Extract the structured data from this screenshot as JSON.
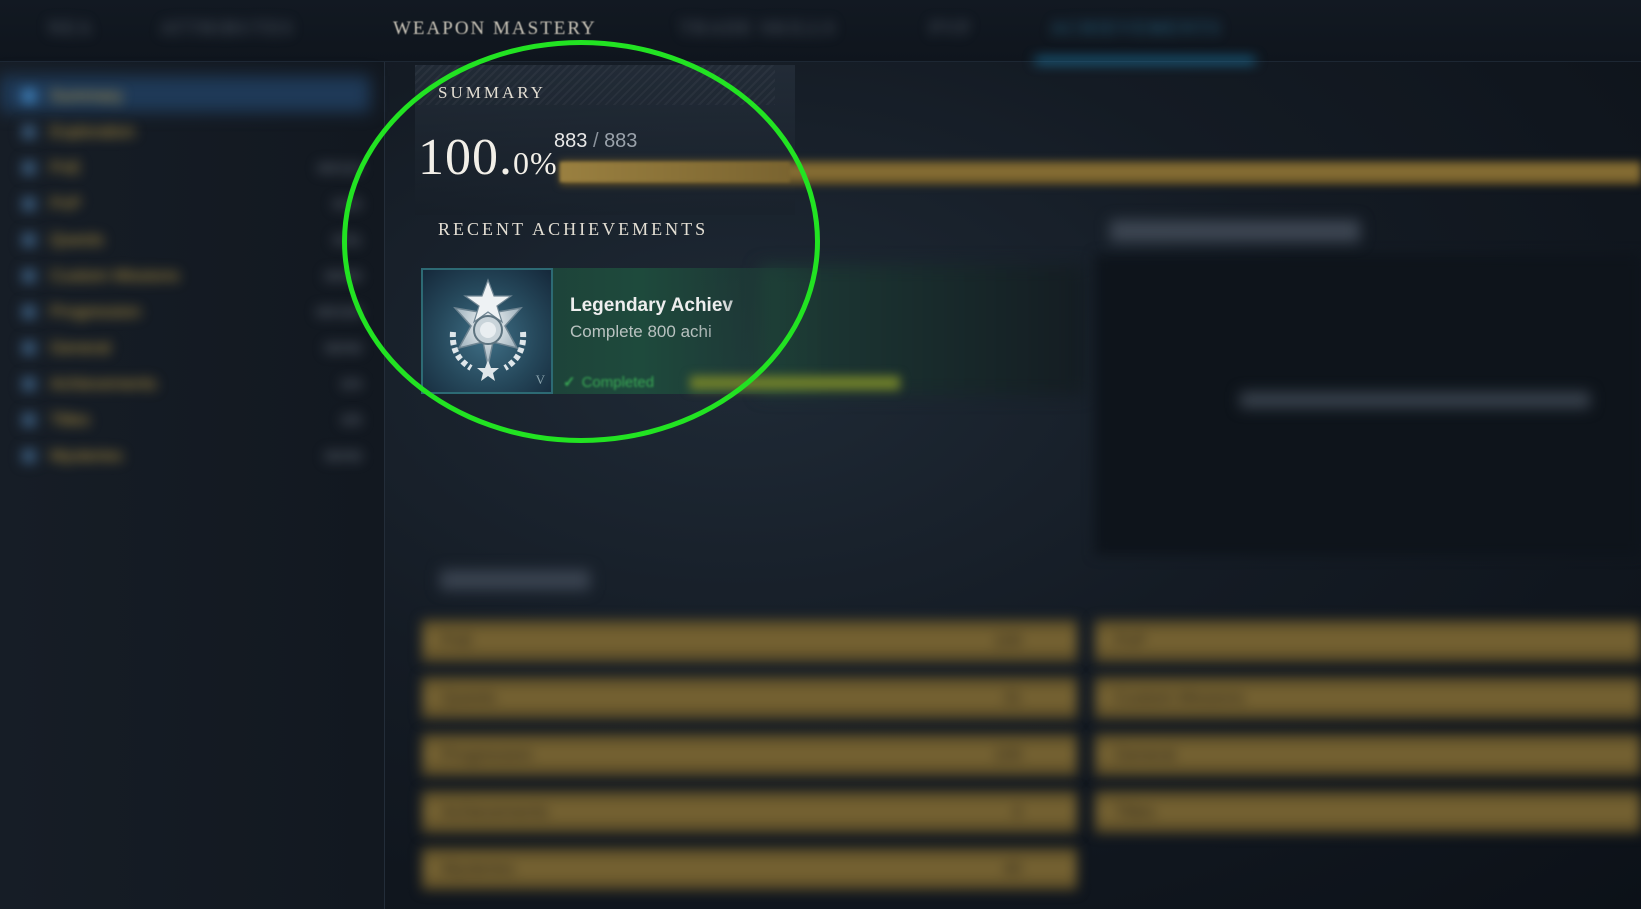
{
  "top_nav": {
    "tabs": [
      {
        "label": "NEA"
      },
      {
        "label": "ATTRIBUTES"
      },
      {
        "label": "WEAPON MASTERY"
      },
      {
        "label": "TRADE SKILLS"
      },
      {
        "label": "PVP"
      },
      {
        "label": "ACHIEVEMENTS"
      }
    ],
    "active_index": 5
  },
  "sidebar": {
    "items": [
      {
        "label": "Summary",
        "count": ""
      },
      {
        "label": "Exploration",
        "count": ""
      },
      {
        "label": "PvE",
        "count": "00/110"
      },
      {
        "label": "PvP",
        "count": "0/15"
      },
      {
        "label": "Quests",
        "count": "0/31"
      },
      {
        "label": "Custom Missions",
        "count": "00/40"
      },
      {
        "label": "Progression",
        "count": "00/100"
      },
      {
        "label": "General",
        "count": "00/40"
      },
      {
        "label": "Achievements",
        "count": "0/4"
      },
      {
        "label": "Titles",
        "count": "0/5"
      },
      {
        "label": "Mysteries",
        "count": "00/40"
      }
    ]
  },
  "summary": {
    "heading": "SUMMARY",
    "percent_main": "100.",
    "percent_decimal": "0%",
    "completed": "883",
    "separator": "/",
    "total": "883",
    "progress": 1.0
  },
  "recent": {
    "heading": "RECENT ACHIEVEMENTS",
    "card": {
      "title": "Legendary Achiev",
      "description": "Complete 800 achi",
      "tier": "V",
      "status": "Completed",
      "icon": "star-medal-icon"
    }
  },
  "right_panel": {
    "title": "NEARLY COMPLETED",
    "empty_text": "No achievements are nearly completed yet"
  },
  "stats": {
    "title": "All Categories",
    "left_rows": [
      {
        "label": "PvE",
        "value": "100"
      },
      {
        "label": "Quests",
        "value": "31"
      },
      {
        "label": "Progression",
        "value": "100"
      },
      {
        "label": "Achievements",
        "value": "4"
      },
      {
        "label": "Mysteries",
        "value": "40"
      }
    ],
    "right_rows": [
      {
        "label": "PvP"
      },
      {
        "label": "Custom Missions"
      },
      {
        "label": "General"
      },
      {
        "label": "Titles"
      }
    ]
  },
  "colors": {
    "accent_gold": "#c9a445",
    "highlight_ring": "#22e322",
    "completed_green": "#3aaa55",
    "active_tab_blue": "#1f87b8"
  }
}
